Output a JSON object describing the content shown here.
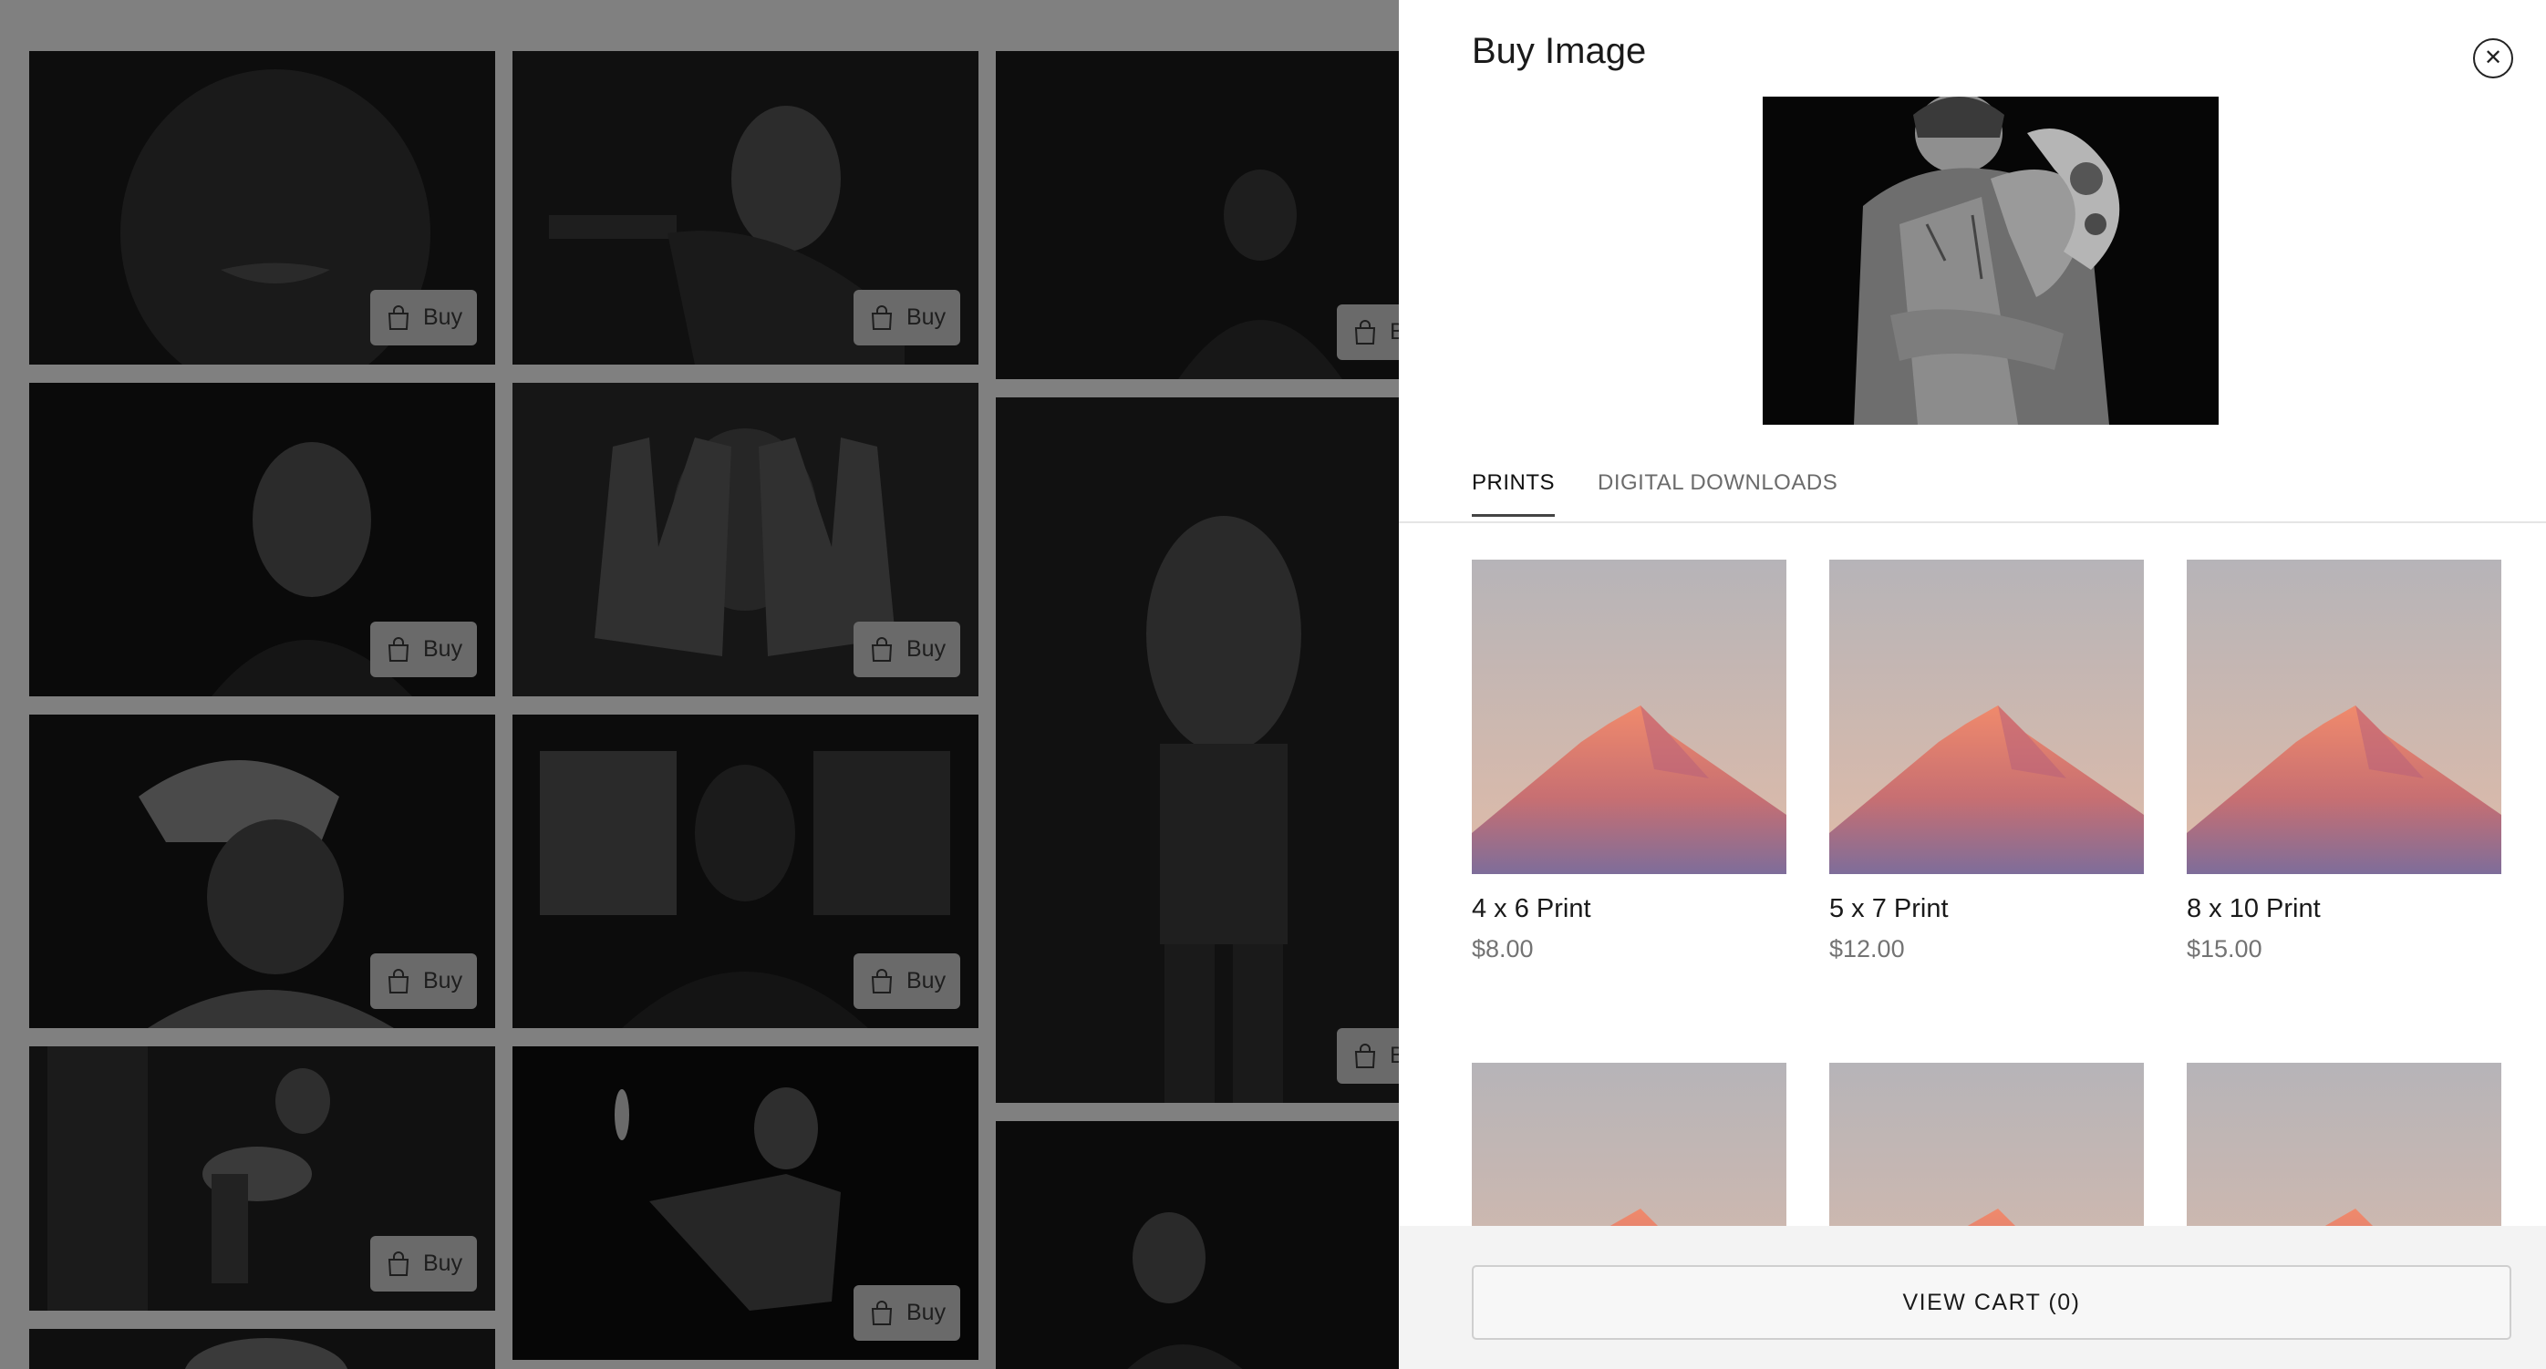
{
  "gallery": {
    "buy_label": "Buy"
  },
  "drawer": {
    "title": "Buy Image",
    "close_icon": "close-circle-icon",
    "tabs": [
      {
        "label": "PRINTS",
        "active": true
      },
      {
        "label": "DIGITAL DOWNLOADS",
        "active": false
      }
    ],
    "products": [
      {
        "name": "4 x 6 Print",
        "price": "$8.00"
      },
      {
        "name": "5 x 7 Print",
        "price": "$12.00"
      },
      {
        "name": "8 x 10 Print",
        "price": "$15.00"
      },
      {
        "name": "",
        "price": ""
      },
      {
        "name": "",
        "price": ""
      },
      {
        "name": "",
        "price": ""
      }
    ],
    "view_cart_label": "VIEW CART (0)"
  },
  "colors": {
    "overlay": "#808080",
    "drawer_bg": "#ffffff",
    "footer_bg": "#f3f3f3",
    "mountain": "#e07a62"
  }
}
